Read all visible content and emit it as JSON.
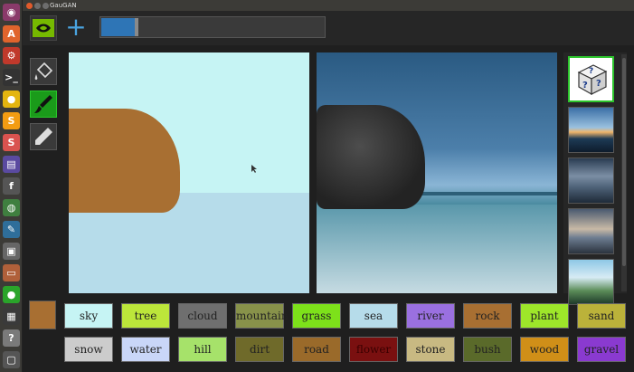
{
  "window": {
    "title": "GauGAN"
  },
  "launcher": [
    {
      "name": "ubuntu-dash-icon",
      "glyph": "◉",
      "color": "#8a3a6a"
    },
    {
      "name": "software-center-icon",
      "glyph": "A",
      "color": "#e0642c"
    },
    {
      "name": "settings-icon",
      "glyph": "⚙",
      "color": "#c0392b"
    },
    {
      "name": "terminal-icon",
      "glyph": ">_",
      "color": "#333333"
    },
    {
      "name": "chrome-icon",
      "glyph": "●",
      "color": "#e4b50f"
    },
    {
      "name": "sublime-icon",
      "glyph": "S",
      "color": "#f39c12"
    },
    {
      "name": "slides-icon",
      "glyph": "S",
      "color": "#d9534f"
    },
    {
      "name": "shell-icon",
      "glyph": "▤",
      "color": "#5a4aa0"
    },
    {
      "name": "fontforge-icon",
      "glyph": "f",
      "color": "#555555"
    },
    {
      "name": "globe-icon",
      "glyph": "◍",
      "color": "#3f7f3f"
    },
    {
      "name": "brush-app-icon",
      "glyph": "✎",
      "color": "#2f6e9a"
    },
    {
      "name": "chip-icon",
      "glyph": "▣",
      "color": "#666666"
    },
    {
      "name": "drive-icon",
      "glyph": "▭",
      "color": "#b0603a"
    },
    {
      "name": "sphere-icon",
      "glyph": "●",
      "color": "#2aa42a"
    },
    {
      "name": "monitor-icon",
      "glyph": "▦",
      "color": "#3a3a3a"
    },
    {
      "name": "help-icon",
      "glyph": "?",
      "color": "#7a7a7a"
    },
    {
      "name": "trash-icon",
      "glyph": "▢",
      "color": "#555555"
    }
  ],
  "toolbar": {
    "progress_fraction": 0.15,
    "accent": "#2e75b6",
    "brand_color": "#76b900"
  },
  "tools": [
    {
      "name": "paint-bucket-icon",
      "active": false
    },
    {
      "name": "brush-icon",
      "active": true
    },
    {
      "name": "pencil-icon",
      "active": false
    }
  ],
  "current_label_color": "#a86f32",
  "labels": [
    {
      "text": "sky",
      "color": "#c6f4f4"
    },
    {
      "text": "tree",
      "color": "#bce63a"
    },
    {
      "text": "cloud",
      "color": "#6f6f6f"
    },
    {
      "text": "mountain",
      "color": "#88924a"
    },
    {
      "text": "grass",
      "color": "#7de11a"
    },
    {
      "text": "sea",
      "color": "#b6dcea"
    },
    {
      "text": "river",
      "color": "#9a70e0"
    },
    {
      "text": "rock",
      "color": "#a86f32"
    },
    {
      "text": "plant",
      "color": "#9ee62a"
    },
    {
      "text": "sand",
      "color": "#bbb23a"
    },
    {
      "text": "snow",
      "color": "#cccccc"
    },
    {
      "text": "water",
      "color": "#c9d6f8"
    },
    {
      "text": "hill",
      "color": "#a6e26a"
    },
    {
      "text": "dirt",
      "color": "#6f6a2a"
    },
    {
      "text": "road",
      "color": "#9a6a2a"
    },
    {
      "text": "flower",
      "color": "#7a1010"
    },
    {
      "text": "stone",
      "color": "#c8b982"
    },
    {
      "text": "bush",
      "color": "#5a6a2a"
    },
    {
      "text": "wood",
      "color": "#d08f18"
    },
    {
      "text": "gravel",
      "color": "#8a3ad0"
    }
  ],
  "thumbnails": [
    {
      "name": "random-style-dice",
      "kind": "dice"
    },
    {
      "name": "style-sunset-lake",
      "kind": "sunset"
    },
    {
      "name": "style-cloudy-sea",
      "kind": "cloudy"
    },
    {
      "name": "style-dusk-beach",
      "kind": "dusk"
    },
    {
      "name": "style-waves",
      "kind": "waves"
    }
  ]
}
